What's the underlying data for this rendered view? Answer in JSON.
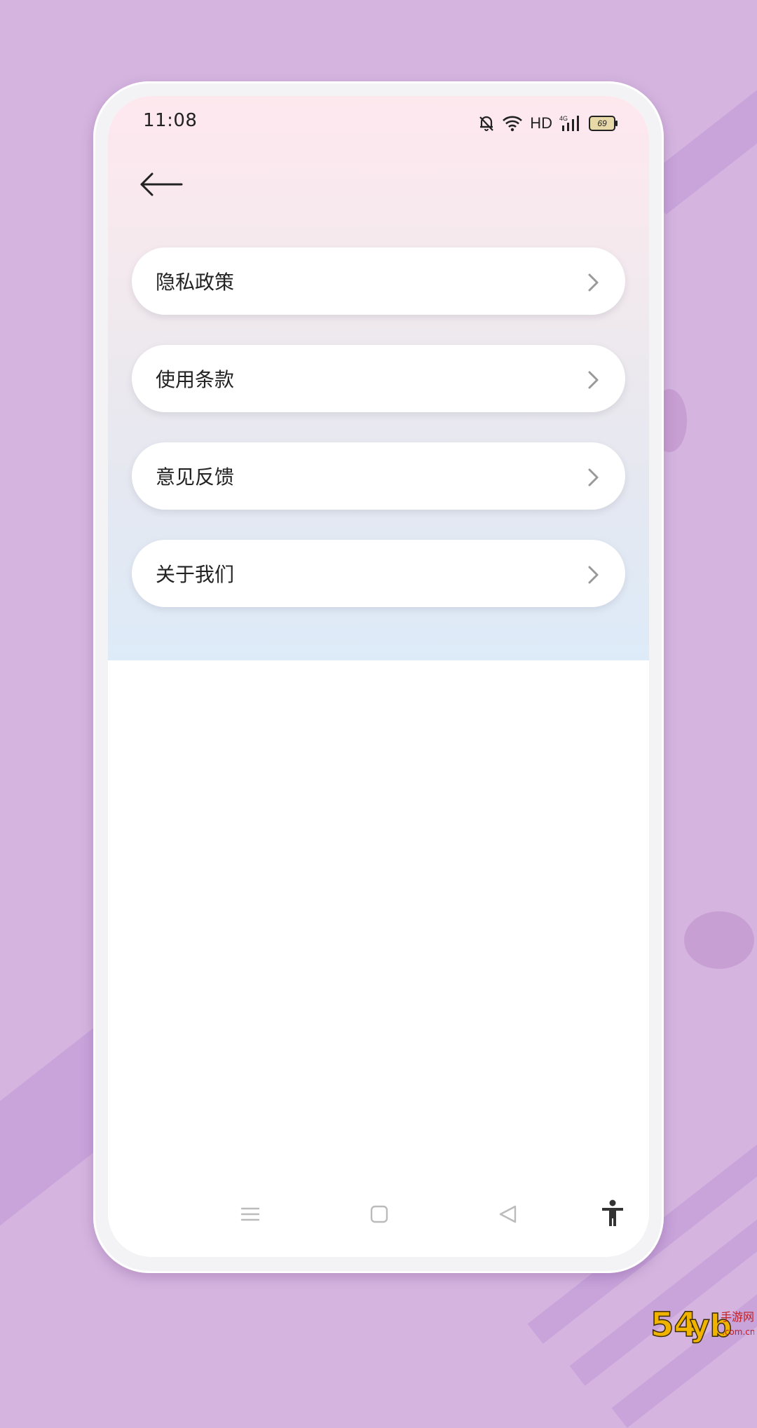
{
  "status_bar": {
    "time": "11:08",
    "network_label": "HD",
    "signal_label": "4G",
    "battery_level": "69"
  },
  "header": {
    "back_icon": "arrow-left-icon"
  },
  "menu": {
    "items": [
      {
        "label": "隐私政策",
        "icon": "chevron-right-icon"
      },
      {
        "label": "使用条款",
        "icon": "chevron-right-icon"
      },
      {
        "label": "意见反馈",
        "icon": "chevron-right-icon"
      },
      {
        "label": "关于我们",
        "icon": "chevron-right-icon"
      }
    ]
  },
  "nav_bar": {
    "icons": [
      "menu-icon",
      "home-square-icon",
      "back-triangle-icon",
      "accessibility-icon"
    ]
  },
  "watermark": {
    "text": "54yb手游网 .com.cn"
  },
  "colors": {
    "background": "#d5b5e0",
    "gradient_top": "#fde8ee",
    "gradient_bottom": "#ddebf8",
    "card": "#ffffff",
    "text": "#222222",
    "chevron": "#999999"
  }
}
